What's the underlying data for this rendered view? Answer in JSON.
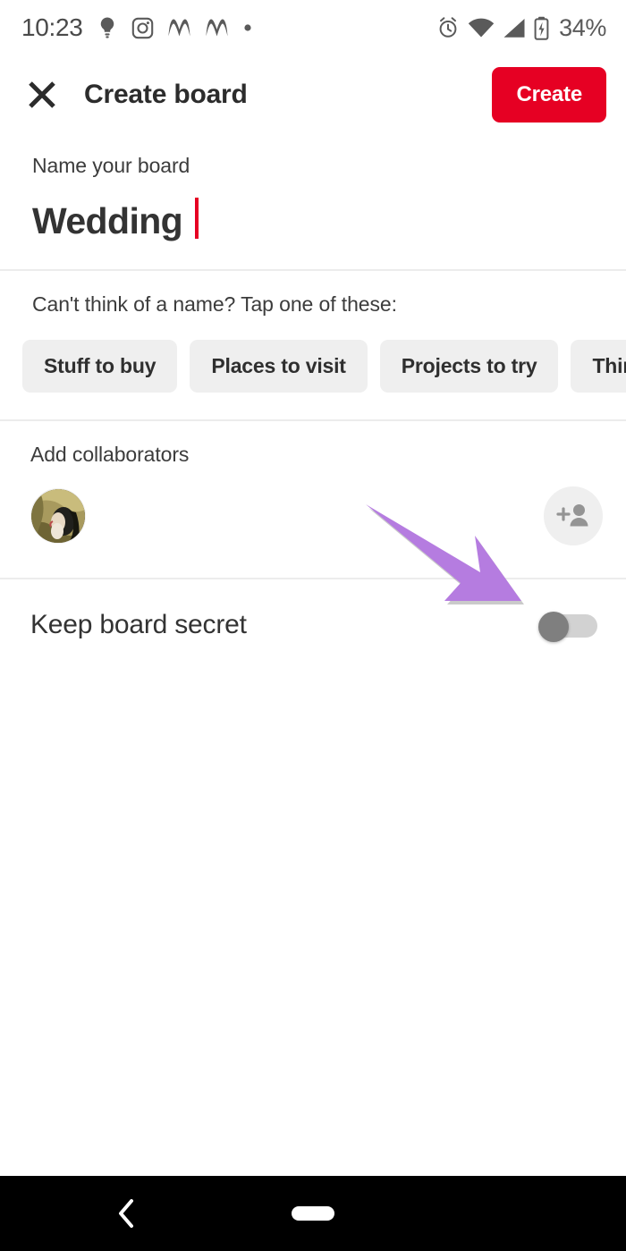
{
  "status_bar": {
    "time": "10:23",
    "battery_percent": "34%",
    "left_icons": [
      "lightbulb-icon",
      "instagram-icon",
      "m-app-icon",
      "m-app-icon-2",
      "dot-icon"
    ],
    "right_icons": [
      "alarm-icon",
      "wifi-icon",
      "cellular-signal-icon",
      "battery-charging-icon"
    ]
  },
  "header": {
    "close_icon": "close-x-icon",
    "title": "Create board",
    "create_label": "Create",
    "accent_color": "#e60023"
  },
  "name_section": {
    "label": "Name your board",
    "value": "Wedding",
    "caret_color": "#e60023"
  },
  "suggestions": {
    "label": "Can't think of a name? Tap one of these:",
    "chips": [
      "Stuff to buy",
      "Places to visit",
      "Projects to try",
      "Thing"
    ]
  },
  "collaborators": {
    "label": "Add collaborators",
    "avatar_name": "collaborator-avatar",
    "add_icon": "add-person-icon"
  },
  "secret": {
    "label": "Keep board secret",
    "toggle_state": "off",
    "toggle_on_color": "#e60023",
    "toggle_off_color": "#7f7f7f"
  },
  "annotation": {
    "arrow_name": "highlight-arrow",
    "arrow_color": "#b57ce0",
    "points_to": "Keep board secret toggle"
  },
  "nav_bar": {
    "back_icon": "back-chevron-icon",
    "home_icon": "home-pill-icon",
    "background_color": "#000000"
  }
}
